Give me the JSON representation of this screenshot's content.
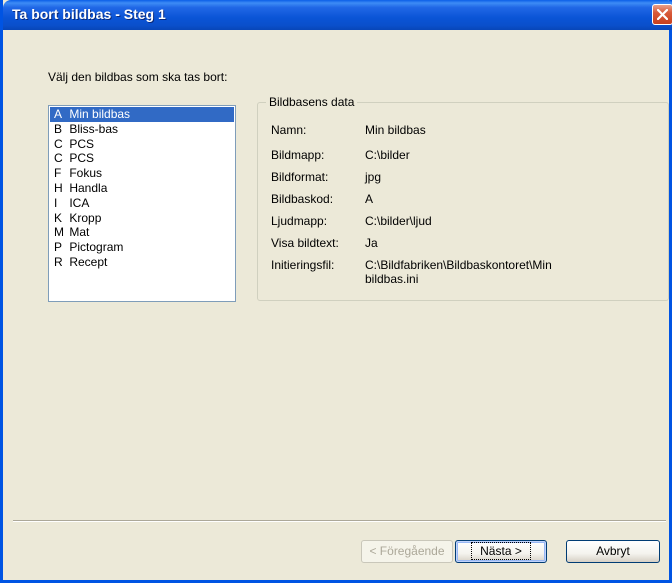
{
  "window": {
    "title": "Ta bort bildbas - Steg 1"
  },
  "prompt": "Välj den bildbas som ska tas bort:",
  "list": {
    "items": [
      {
        "code": "A",
        "name": "Min bildbas",
        "selected": true
      },
      {
        "code": "B",
        "name": "Bliss-bas",
        "selected": false
      },
      {
        "code": "C",
        "name": "PCS",
        "selected": false
      },
      {
        "code": "C",
        "name": "PCS",
        "selected": false
      },
      {
        "code": "F",
        "name": "Fokus",
        "selected": false
      },
      {
        "code": "H",
        "name": "Handla",
        "selected": false
      },
      {
        "code": "I",
        "name": "ICA",
        "selected": false
      },
      {
        "code": "K",
        "name": "Kropp",
        "selected": false
      },
      {
        "code": "M",
        "name": "Mat",
        "selected": false
      },
      {
        "code": "P",
        "name": "Pictogram",
        "selected": false
      },
      {
        "code": "R",
        "name": "Recept",
        "selected": false
      }
    ]
  },
  "details": {
    "legend": "Bildbasens data",
    "rows": [
      {
        "label": "Namn:",
        "value": "Min bildbas"
      },
      {
        "label": "Bildmapp:",
        "value": "C:\\bilder"
      },
      {
        "label": "Bildformat:",
        "value": "jpg"
      },
      {
        "label": "Bildbaskod:",
        "value": "A"
      },
      {
        "label": "Ljudmapp:",
        "value": "C:\\bilder\\ljud"
      },
      {
        "label": "Visa bildtext:",
        "value": "Ja"
      },
      {
        "label": "Initieringsfil:",
        "value": "C:\\Bildfabriken\\Bildbaskontoret\\Min bildbas.ini"
      }
    ]
  },
  "buttons": {
    "back": "< Föregående",
    "next": "Nästa >",
    "cancel": "Avbryt"
  },
  "colors": {
    "titlebar": "#0A54D6",
    "selection": "#316AC5",
    "dialog": "#ECE9D8"
  }
}
